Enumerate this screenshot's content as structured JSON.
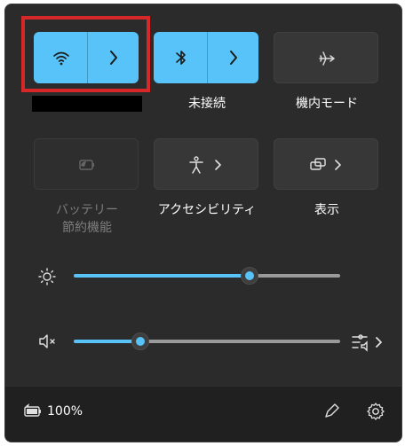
{
  "tiles": {
    "bluetooth_label": "未接続",
    "airplane_label": "機内モード",
    "battery_saver_label_line1": "バッテリー",
    "battery_saver_label_line2": "節約機能",
    "accessibility_label": "アクセシビリティ",
    "display_label": "表示"
  },
  "sliders": {
    "brightness": 0.66,
    "volume": 0.25
  },
  "footer": {
    "battery_text": "100%"
  },
  "colors": {
    "accent": "#57c3f9",
    "panel": "#2b2b2b",
    "highlight": "#d62828"
  },
  "icons": {
    "wifi": "wifi-icon",
    "bluetooth": "bluetooth-icon",
    "airplane": "airplane-icon",
    "battery_saver": "battery-saver-icon",
    "accessibility": "accessibility-icon",
    "display": "display-icon",
    "brightness": "brightness-icon",
    "volume_muted": "volume-muted-icon",
    "audio_output": "audio-output-icon",
    "edit": "pencil-icon",
    "settings": "gear-icon",
    "battery": "battery-icon"
  }
}
